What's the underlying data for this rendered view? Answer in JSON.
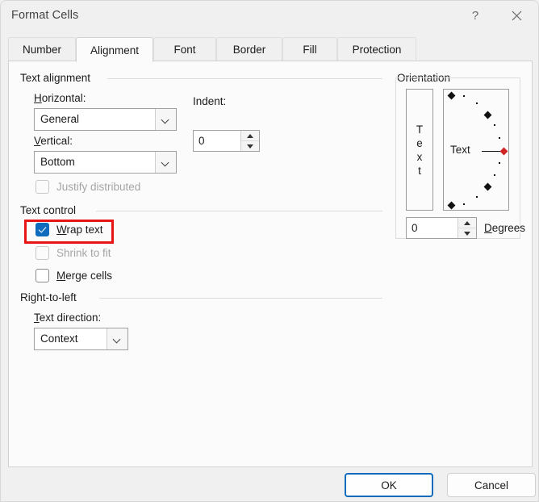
{
  "window": {
    "title": "Format Cells",
    "help_icon": "question-mark-icon",
    "close_icon": "close-icon"
  },
  "tabs": [
    {
      "label": "Number",
      "active": false
    },
    {
      "label": "Alignment",
      "active": true
    },
    {
      "label": "Font",
      "active": false
    },
    {
      "label": "Border",
      "active": false
    },
    {
      "label": "Fill",
      "active": false
    },
    {
      "label": "Protection",
      "active": false
    }
  ],
  "text_alignment": {
    "group_label": "Text alignment",
    "horizontal_label": "Horizontal:",
    "horizontal_value": "General",
    "vertical_label": "Vertical:",
    "vertical_value": "Bottom",
    "indent_label": "Indent:",
    "indent_value": "0",
    "justify_distributed_label": "Justify distributed",
    "justify_distributed_checked": false,
    "justify_distributed_enabled": false
  },
  "text_control": {
    "group_label": "Text control",
    "wrap_text_label": "Wrap text",
    "wrap_text_checked": true,
    "shrink_to_fit_label": "Shrink to fit",
    "shrink_to_fit_checked": false,
    "shrink_to_fit_enabled": false,
    "merge_cells_label": "Merge cells",
    "merge_cells_checked": false
  },
  "right_to_left": {
    "group_label": "Right-to-left",
    "text_direction_label": "Text direction:",
    "text_direction_value": "Context"
  },
  "orientation": {
    "group_label": "Orientation",
    "vertical_text_letters": [
      "T",
      "e",
      "x",
      "t"
    ],
    "dial_label": "Text",
    "degrees_value": "0",
    "degrees_label": "Degrees"
  },
  "footer": {
    "ok_label": "OK",
    "cancel_label": "Cancel"
  },
  "colors": {
    "accent": "#0f6cbd",
    "highlight": "#e81313",
    "handle": "#cf2525",
    "panel_bg": "#fbfbfb",
    "dialog_bg": "#f0f0f0"
  }
}
